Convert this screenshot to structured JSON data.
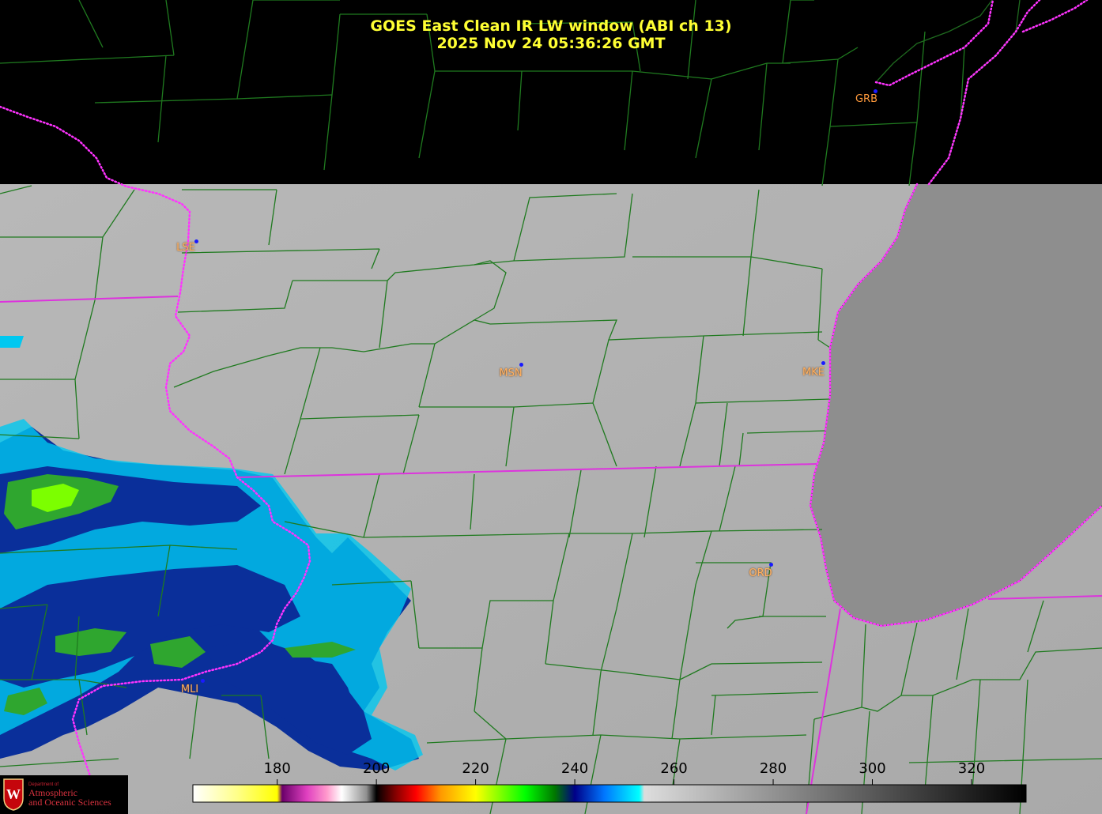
{
  "title": {
    "line1": "GOES East Clean IR LW window (ABI ch 13)",
    "line2": "2025 Nov 24  05:36:26 GMT"
  },
  "stations": [
    "GRB",
    "LSE",
    "MSN",
    "MKE",
    "ORD",
    "MLI"
  ],
  "colorbar": {
    "tick_labels": [
      "180",
      "200",
      "220",
      "240",
      "260",
      "280",
      "300",
      "320"
    ],
    "tick_values": [
      180,
      200,
      220,
      240,
      260,
      280,
      300,
      320
    ],
    "range": [
      163,
      331
    ],
    "stops": [
      {
        "v": 163,
        "c": "#ffffff"
      },
      {
        "v": 172,
        "c": "#ffff88"
      },
      {
        "v": 180,
        "c": "#ffff00"
      },
      {
        "v": 181,
        "c": "#6a006a"
      },
      {
        "v": 186,
        "c": "#e040c0"
      },
      {
        "v": 190,
        "c": "#ff99cc"
      },
      {
        "v": 193,
        "c": "#ffffff"
      },
      {
        "v": 198,
        "c": "#909090"
      },
      {
        "v": 200,
        "c": "#000000"
      },
      {
        "v": 204,
        "c": "#880000"
      },
      {
        "v": 208,
        "c": "#ff0000"
      },
      {
        "v": 213,
        "c": "#ff9900"
      },
      {
        "v": 220,
        "c": "#ffff00"
      },
      {
        "v": 230,
        "c": "#00ff00"
      },
      {
        "v": 236,
        "c": "#007700"
      },
      {
        "v": 240,
        "c": "#000088"
      },
      {
        "v": 246,
        "c": "#0077ff"
      },
      {
        "v": 253,
        "c": "#00ffff"
      },
      {
        "v": 254,
        "c": "#dddddd"
      },
      {
        "v": 331,
        "c": "#000000"
      }
    ]
  },
  "logo": {
    "small": "Department of",
    "line1": "Atmospheric",
    "line2": "and Oceanic Sciences",
    "seal_letter": "W"
  },
  "colors": {
    "title": "#ffff33",
    "county_lines": "#1f7a1f",
    "state_lines": "#dd33dd",
    "station_label": "#ff9a3c",
    "station_dot": "#1a1aff"
  }
}
